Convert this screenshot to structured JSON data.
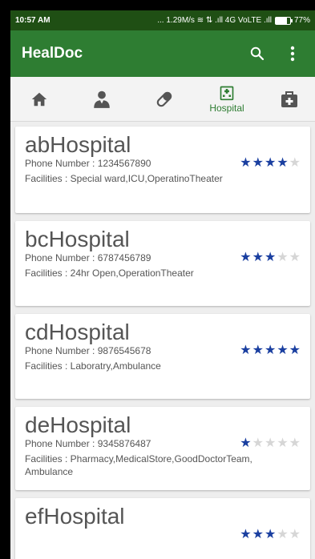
{
  "status_bar": {
    "time": "10:57 AM",
    "indicators": "... 1.29M/s ≋ ⇅ .ıll 4G VoLTE .ıll",
    "battery_label": "77%",
    "battery_level": 0.77
  },
  "app_bar": {
    "title": "HealDoc",
    "actions": [
      "search-icon",
      "more-vert-icon"
    ]
  },
  "tabs": [
    {
      "icon": "home-icon",
      "label": ""
    },
    {
      "icon": "doctor-icon",
      "label": ""
    },
    {
      "icon": "pill-icon",
      "label": ""
    },
    {
      "icon": "hospital-icon",
      "label": "Hospital"
    },
    {
      "icon": "first-aid-kit-icon",
      "label": ""
    }
  ],
  "colors": {
    "status_bar": "#1f4f14",
    "app_bar": "#2e7d32",
    "accent": "#2e7d32",
    "star_on": "#1a3fa0",
    "star_off": "#d6d6d6"
  },
  "hospitals": [
    {
      "name": "abHospital",
      "phone": "Phone Number : 1234567890",
      "facilities": "Facilities : Special ward,ICU,OperatinoTheater",
      "rating": 4,
      "max_rating": 5
    },
    {
      "name": "bcHospital",
      "phone": "Phone Number : 6787456789",
      "facilities": "Facilities : 24hr Open,OperationTheater",
      "rating": 3,
      "max_rating": 5
    },
    {
      "name": "cdHospital",
      "phone": "Phone Number : 9876545678",
      "facilities": "Facilities : Laboratry,Ambulance",
      "rating": 5,
      "max_rating": 5
    },
    {
      "name": "deHospital",
      "phone": "Phone Number : 9345876487",
      "facilities": "Facilities : Pharmacy,MedicalStore,GoodDoctorTeam, Ambulance",
      "rating": 1,
      "max_rating": 5
    },
    {
      "name": "efHospital",
      "phone": "",
      "facilities": "",
      "rating": 3,
      "max_rating": 5
    }
  ]
}
